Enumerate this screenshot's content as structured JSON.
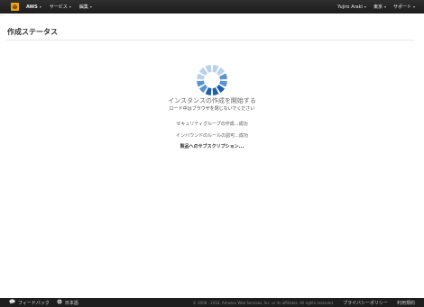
{
  "topbar": {
    "brand": "AWS",
    "services": "サービス",
    "edit": "編集",
    "user": "Yujiro Araki",
    "region": "東京",
    "support": "サポート"
  },
  "page": {
    "title": "作成ステータス"
  },
  "status": {
    "heading": "インスタンスの作成を開始する",
    "subtext": "ロード中はブラウザを閉じないでください",
    "steps": [
      "セキュリティグループの作成...成功",
      "インバウンドのルールの認可...成功",
      "製品へのサブスクリプション..."
    ]
  },
  "footer": {
    "feedback": "フィードバック",
    "language": "日本語",
    "copyright": "© 2008 - 2016, Amazon Web Services, Inc. or its affiliates. All rights reserved.",
    "privacy": "プライバシーポリシー",
    "terms": "利用規約"
  },
  "colors": {
    "topbar": "#1c1c1c",
    "logo": "#f0a30a",
    "spinner_dark": "#1f5fa8",
    "spinner_mid": "#5b93cf",
    "spinner_light": "#b9d2ea",
    "footer": "#1e1e1e"
  },
  "icons": [
    "aws-logo-icon",
    "spinner-icon",
    "chat-bubble-icon",
    "globe-icon"
  ]
}
